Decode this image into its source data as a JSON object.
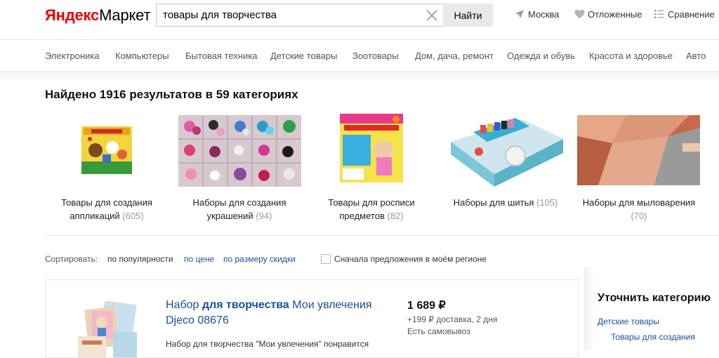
{
  "header": {
    "logo_yandex": "Яндекс",
    "logo_market": "Маркет",
    "search": {
      "value": "товары для творчества",
      "button": "Найти"
    },
    "region": "Москва",
    "deferred": "Отложенные",
    "compare": "Сравнение"
  },
  "category_nav": [
    "Электроника",
    "Компьютеры",
    "Бытовая техника",
    "Детские товары",
    "Зоотовары",
    "Дом, дача, ремонт",
    "Одежда и обувь",
    "Красота и здоровье",
    "Авто"
  ],
  "results_title": "Найдено 1916 результатов в 59 категориях",
  "categories": [
    {
      "line1": "Товары для создания",
      "line2": "аппликаций",
      "count": "(605)"
    },
    {
      "line1": "Наборы для создания",
      "line2": "украшений",
      "count": "(94)"
    },
    {
      "line1": "Товары для росписи",
      "line2": "предметов",
      "count": "(82)"
    },
    {
      "line1": "Наборы для шитья",
      "line2": "",
      "count": "(105)"
    },
    {
      "line1": "Наборы для мыловарения",
      "line2": "",
      "count": "(70)"
    }
  ],
  "sort": {
    "label": "Сортировать:",
    "options": [
      "по популярности",
      "по цене",
      "по размеру скидки"
    ],
    "region_checkbox": "Сначала предложения в моём регионе"
  },
  "product": {
    "title_prefix": "Набор",
    "title_bold": "для творчества",
    "title_suffix": "Мои увлечения",
    "title_line2": "Djeco 08676",
    "price": "1 689 ₽",
    "delivery": "+199 ₽ доставка, 2 дня",
    "pickup": "Есть самовывоз",
    "description": "Набор для творчества \"Мои увлечения\" понравится"
  },
  "refine": {
    "title": "Уточнить категорию",
    "links": [
      "Детские товары",
      "Товары для создания"
    ]
  },
  "colors": {
    "brand_red": "#e00000",
    "link_blue": "#1a4f96",
    "muted_gray": "#999999"
  },
  "icons": [
    "clear-icon",
    "location-arrow-icon",
    "heart-icon",
    "compare-list-icon"
  ]
}
